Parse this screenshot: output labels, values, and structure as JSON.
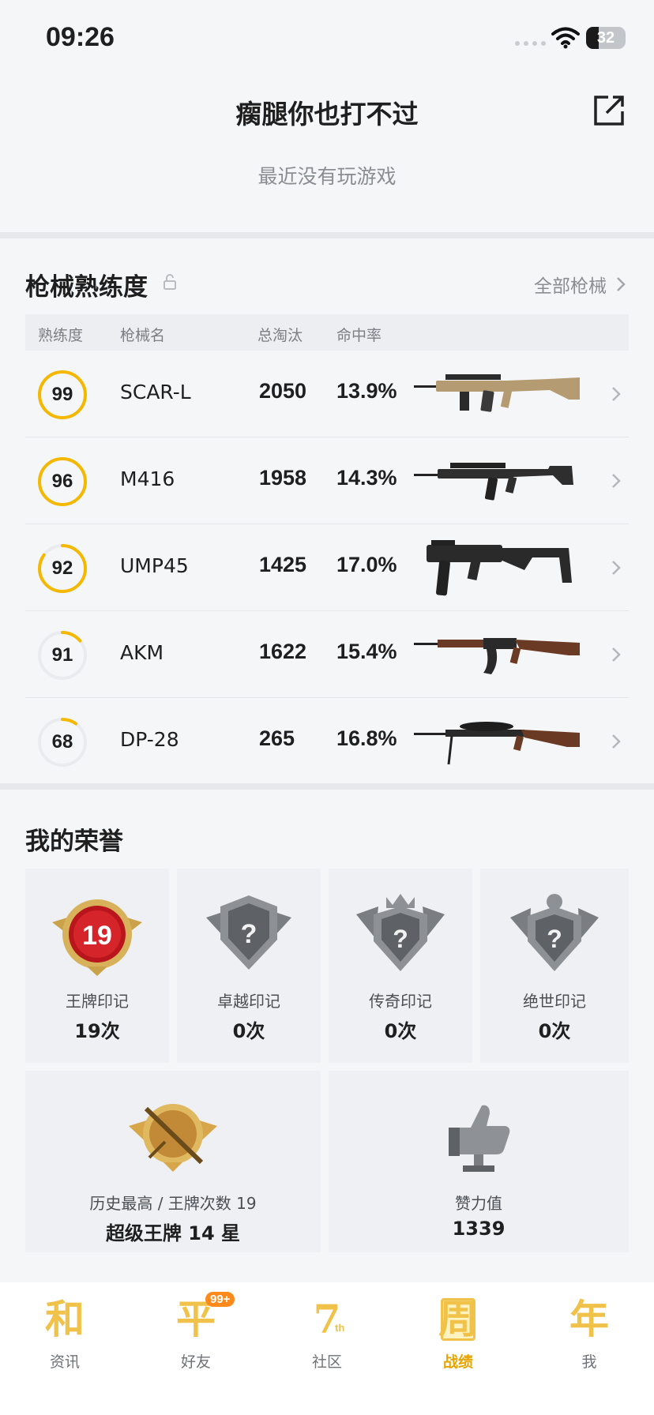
{
  "status_bar": {
    "time": "09:26",
    "battery": "32",
    "battery_level": 0.32
  },
  "header": {
    "name": "瘸腿你也打不过",
    "status": "最近没有玩游戏"
  },
  "weapons": {
    "title": "枪械熟练度",
    "all_link": "全部枪械",
    "columns": {
      "proficiency": "熟练度",
      "name": "枪械名",
      "kills": "总淘汰",
      "accuracy": "命中率"
    },
    "rows": [
      {
        "proficiency": "99",
        "level": 1.0,
        "name": "SCAR-L",
        "kills": "2050",
        "accuracy": "13.9%",
        "weapon_icon": "scar-l-rifle-icon"
      },
      {
        "proficiency": "96",
        "level": 1.0,
        "name": "M416",
        "kills": "1958",
        "accuracy": "14.3%",
        "weapon_icon": "m416-rifle-icon"
      },
      {
        "proficiency": "92",
        "level": 0.85,
        "name": "UMP45",
        "kills": "1425",
        "accuracy": "17.0%",
        "weapon_icon": "ump45-smg-icon"
      },
      {
        "proficiency": "91",
        "level": 0.14,
        "name": "AKM",
        "kills": "1622",
        "accuracy": "15.4%",
        "weapon_icon": "akm-rifle-icon"
      },
      {
        "proficiency": "68",
        "level": 0.1,
        "name": "DP-28",
        "kills": "265",
        "accuracy": "16.8%",
        "weapon_icon": "dp28-lmg-icon"
      }
    ]
  },
  "honors": {
    "title": "我的荣誉",
    "badges": [
      {
        "label": "王牌印记",
        "count": "19次",
        "badge_number": "19"
      },
      {
        "label": "卓越印记",
        "count": "0次",
        "badge_number": "?"
      },
      {
        "label": "传奇印记",
        "count": "0次",
        "badge_number": "?"
      },
      {
        "label": "绝世印记",
        "count": "0次",
        "badge_number": "?"
      }
    ],
    "highest": {
      "label": "历史最高 / 王牌次数 19",
      "value": "超级王牌 14 星"
    },
    "likes": {
      "label": "赞力值",
      "value": "1339"
    }
  },
  "bottom_nav": [
    {
      "glyph": "和",
      "label": "资讯"
    },
    {
      "glyph": "平",
      "label": "好友",
      "badge": "99+"
    },
    {
      "glyph": "7",
      "label": "社区",
      "sup": "th"
    },
    {
      "glyph": "周",
      "label": "战绩",
      "active": true
    },
    {
      "glyph": "年",
      "label": "我"
    }
  ],
  "colors": {
    "accent": "#f5b800",
    "ring_track": "#e9ebee",
    "nav_gold": "#f0c24a"
  }
}
